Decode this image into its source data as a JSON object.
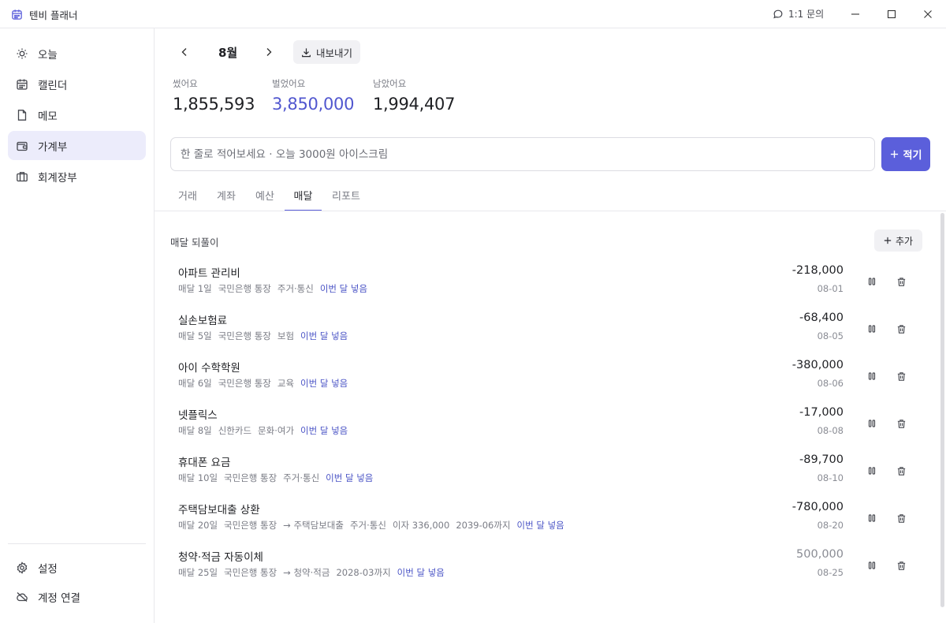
{
  "app": {
    "title": "텐비 플래너",
    "contact_label": "1:1 문의"
  },
  "sidebar": {
    "items": [
      {
        "label": "오늘",
        "icon": "sun-icon"
      },
      {
        "label": "캘린더",
        "icon": "calendar-icon"
      },
      {
        "label": "메모",
        "icon": "file-icon"
      },
      {
        "label": "가계부",
        "icon": "wallet-icon",
        "active": true
      },
      {
        "label": "회계장부",
        "icon": "briefcase-icon"
      }
    ],
    "bottom": [
      {
        "label": "설정",
        "icon": "gear-icon"
      },
      {
        "label": "계정 연결",
        "icon": "cloud-off-icon"
      }
    ]
  },
  "header": {
    "month": "8월",
    "export_label": "내보내기"
  },
  "stats": {
    "spent_label": "썼어요",
    "spent_value": "1,855,593",
    "earned_label": "벌었어요",
    "earned_value": "3,850,000",
    "left_label": "남았어요",
    "left_value": "1,994,407"
  },
  "quick_entry": {
    "placeholder": "한 줄로 적어보세요 · 오늘 3000원 아이스크림",
    "button_label": "적기"
  },
  "tabs": [
    "거래",
    "계좌",
    "예산",
    "매달",
    "리포트"
  ],
  "active_tab": "매달",
  "recurring": {
    "title": "매달 되풀이",
    "add_label": "추가",
    "items": [
      {
        "name": "아파트 관리비",
        "day": "매달 1일",
        "account": "국민은행 통장",
        "extra": "",
        "category": "주거·통신",
        "note": "",
        "status": "이번 달 넣음",
        "amount": "-218,000",
        "date": "08-01"
      },
      {
        "name": "실손보험료",
        "day": "매달 5일",
        "account": "국민은행 통장",
        "extra": "",
        "category": "보험",
        "note": "",
        "status": "이번 달 넣음",
        "amount": "-68,400",
        "date": "08-05"
      },
      {
        "name": "아이 수학학원",
        "day": "매달 6일",
        "account": "국민은행 통장",
        "extra": "",
        "category": "교육",
        "note": "",
        "status": "이번 달 넣음",
        "amount": "-380,000",
        "date": "08-06"
      },
      {
        "name": "넷플릭스",
        "day": "매달 8일",
        "account": "신한카드",
        "extra": "",
        "category": "문화·여가",
        "note": "",
        "status": "이번 달 넣음",
        "amount": "-17,000",
        "date": "08-08"
      },
      {
        "name": "휴대폰 요금",
        "day": "매달 10일",
        "account": "국민은행 통장",
        "extra": "",
        "category": "주거·통신",
        "note": "",
        "status": "이번 달 넣음",
        "amount": "-89,700",
        "date": "08-10"
      },
      {
        "name": "주택담보대출 상환",
        "day": "매달 20일",
        "account": "국민은행 통장",
        "extra": "→ 주택담보대출",
        "category": "주거·통신",
        "note": "이자 336,000",
        "note2": "2039-06까지",
        "status": "이번 달 넣음",
        "amount": "-780,000",
        "date": "08-20"
      },
      {
        "name": "청약·적금 자동이체",
        "day": "매달 25일",
        "account": "국민은행 통장",
        "extra": "→ 청약·적금",
        "category": "",
        "note": "2028-03까지",
        "status": "이번 달 넣음",
        "amount": "500,000",
        "date": "08-25",
        "positive": true
      }
    ]
  },
  "colors": {
    "accent": "#5b5fdb",
    "earned": "#5157cf",
    "active_nav_bg": "#ececfb"
  }
}
